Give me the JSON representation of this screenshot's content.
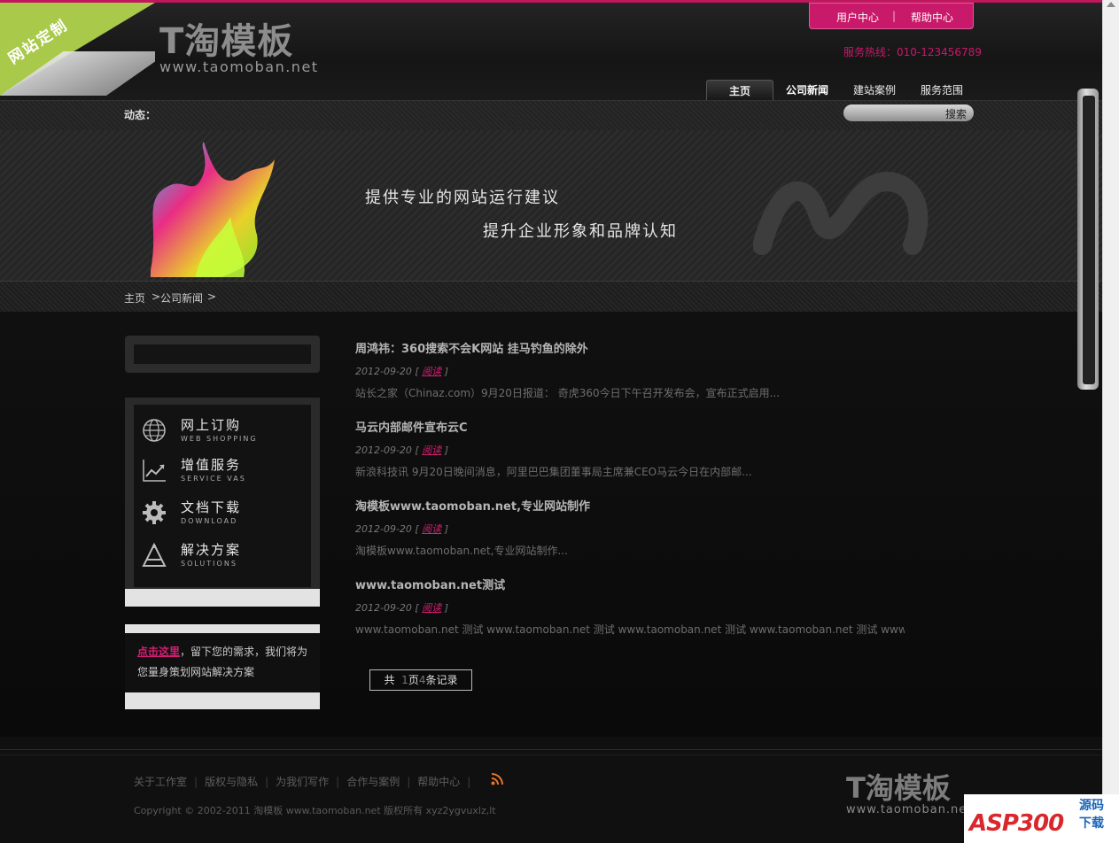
{
  "corner_badge": "网站定制",
  "logo": {
    "big": "T淘模板",
    "small": "www.taomoban.net"
  },
  "user_links": {
    "user_center": "用户中心",
    "separator": "|",
    "help_center": "帮助中心"
  },
  "hotline": "服务热线：010-123456789",
  "nav": [
    "主页",
    "公司新闻",
    "建站案例",
    "服务范围"
  ],
  "news_label": "动态：",
  "search_button": "搜索",
  "banner": {
    "line1": "提供专业的网站运行建议",
    "line2": "提升企业形象和品牌认知"
  },
  "breadcrumb": {
    "home": "主页",
    "sep1": ">",
    "section": "公司新闻",
    "sep2": ">"
  },
  "side_menu": [
    {
      "cn": "网上订购",
      "en": "WEB SHOPPING",
      "icon": "globe-icon"
    },
    {
      "cn": "增值服务",
      "en": "SERVICE VAS",
      "icon": "chart-icon"
    },
    {
      "cn": "文档下载",
      "en": "DOWNLOAD",
      "icon": "gear-icon"
    },
    {
      "cn": "解决方案",
      "en": "SOLUTIONS",
      "icon": "compass-icon"
    }
  ],
  "contact": {
    "link": "点击这里",
    "text": "，留下您的需求，我们将为您量身策划网站解决方案"
  },
  "articles": [
    {
      "title": "周鸿祎：360搜索不会K网站 挂马钓鱼的除外",
      "date": "2012-09-20",
      "read": "阅读",
      "summary": "站长之家（Chinaz.com）9月20日报道： 奇虎360今日下午召开发布会，宣布正式启用..."
    },
    {
      "title": "马云内部邮件宣布云C",
      "date": "2012-09-20",
      "read": "阅读",
      "summary": "新浪科技讯 9月20日晚间消息，阿里巴巴集团董事局主席兼CEO马云今日在内部邮..."
    },
    {
      "title": "淘模板www.taomoban.net,专业网站制作",
      "date": "2012-09-20",
      "read": "阅读",
      "summary": "淘模板www.taomoban.net,专业网站制作..."
    },
    {
      "title": "www.taomoban.net测试",
      "date": "2012-09-20",
      "read": "阅读",
      "summary": "www.taomoban.net 测试 www.taomoban.net 测试 www.taomoban.net 测试 www.taomoban.net 测试 www.t..."
    }
  ],
  "pager": {
    "prefix": "共",
    "pages": "1",
    "page_word": "页",
    "records": "4",
    "record_word": "条记录"
  },
  "footer_links": [
    "关于工作室",
    "版权与隐私",
    "为我们写作",
    "合作与案例",
    "帮助中心"
  ],
  "copyright": "Copyright © 2002-2011 淘模板 www.taomoban.net 版权所有 xyz2ygvuxlz,lt",
  "footer_logo": {
    "big": "T淘模板",
    "small": "www.taomoban.net"
  },
  "watermark": {
    "main": "ASP300",
    "line1": "源码",
    "line2": "下载"
  },
  "colors": {
    "accent": "#c8196a",
    "background": "#0b0b0b"
  }
}
